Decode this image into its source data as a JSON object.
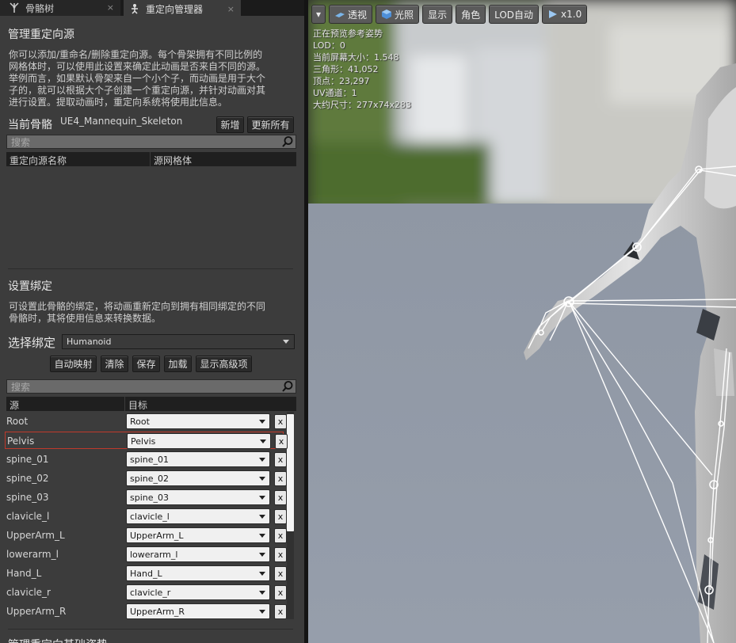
{
  "tabs": [
    {
      "label": "骨骼树",
      "close": "×"
    },
    {
      "label": "重定向管理器",
      "close": "×"
    }
  ],
  "manage_sources": {
    "title": "管理重定向源",
    "desc_lines": [
      "你可以添加/重命名/删除重定向源。每个骨架拥有不同比例的",
      "网格体时，可以使用此设置来确定此动画是否来自不同的源。",
      "举例而言，如果默认骨架来自一个小个子，而动画是用于大个",
      "子的，就可以根据大个子创建一个重定向源，并针对动画对其",
      "进行设置。提取动画时，重定向系统将使用此信息。"
    ]
  },
  "current_skeleton": {
    "label": "当前骨骼",
    "value": "UE4_Mannequin_Skeleton",
    "add_button": "新增",
    "update_all_button": "更新所有",
    "search_placeholder": "搜索",
    "col_name": "重定向源名称",
    "col_mesh": "源网格体"
  },
  "rig_setup": {
    "title": "设置绑定",
    "desc_lines": [
      "可设置此骨骼的绑定，将动画重新定向到拥有相同绑定的不同",
      "骨骼时，其将使用信息来转换数据。"
    ],
    "select_label": "选择绑定",
    "select_value": "Humanoid",
    "buttons": {
      "auto_map": "自动映射",
      "clear": "清除",
      "save": "保存",
      "load": "加载",
      "advanced": "显示高级项"
    },
    "search_placeholder": "搜索",
    "col_source": "源",
    "col_target": "目标",
    "clear_x": "x",
    "mappings": [
      {
        "source": "Root",
        "target": "Root"
      },
      {
        "source": "Pelvis",
        "target": "Pelvis"
      },
      {
        "source": "spine_01",
        "target": "spine_01"
      },
      {
        "source": "spine_02",
        "target": "spine_02"
      },
      {
        "source": "spine_03",
        "target": "spine_03"
      },
      {
        "source": "clavicle_l",
        "target": "clavicle_l"
      },
      {
        "source": "UpperArm_L",
        "target": "UpperArm_L"
      },
      {
        "source": "lowerarm_l",
        "target": "lowerarm_l"
      },
      {
        "source": "Hand_L",
        "target": "Hand_L"
      },
      {
        "source": "clavicle_r",
        "target": "clavicle_r"
      },
      {
        "source": "UpperArm_R",
        "target": "UpperArm_R"
      }
    ],
    "selected_row": 1
  },
  "bottom_section_title": "管理重定向基础姿势",
  "viewport": {
    "toolbar": {
      "menu": "▾",
      "perspective": "透视",
      "lit": "光照",
      "show": "显示",
      "character": "角色",
      "lod": "LOD自动",
      "speed": "x1.0"
    },
    "stats": [
      "正在预览参考姿势",
      "LOD：0",
      "当前屏幕大小：1.548",
      "三角形：41,052",
      "顶点：23,297",
      "UV通道：1",
      "大约尺寸：277x74x283"
    ]
  },
  "colors": {
    "panel_bg": "#3c3c3c",
    "selected_border": "#c0392b",
    "floor": "#8e96a3"
  }
}
